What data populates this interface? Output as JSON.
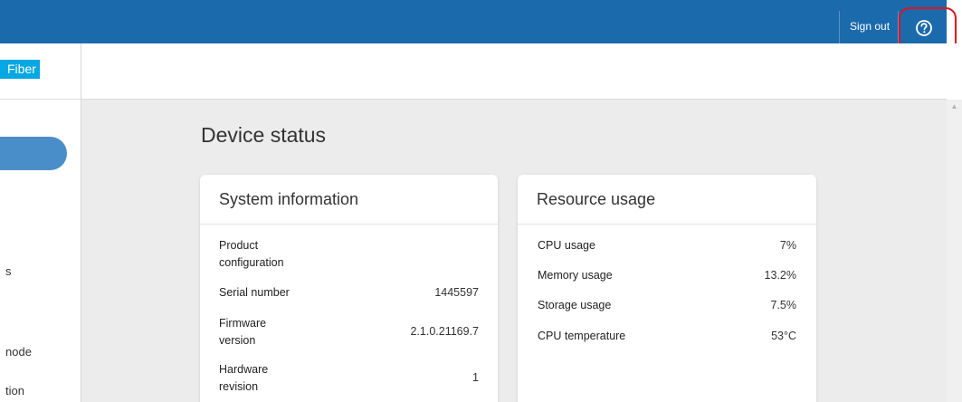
{
  "topbar": {
    "sign_out_label": "Sign out",
    "help_icon": "question-circle-icon"
  },
  "sidebar": {
    "logo_text": "Fiber",
    "items": [
      {
        "label": "s"
      },
      {
        "label": "node"
      },
      {
        "label": "tion"
      }
    ]
  },
  "main": {
    "title": "Device status",
    "system_info": {
      "title": "System information",
      "rows": [
        {
          "label": "Product configuration",
          "value": ""
        },
        {
          "label": "Serial number",
          "value": "1445597"
        },
        {
          "label": "Firmware version",
          "value": "2.1.0.21169.7"
        },
        {
          "label": "Hardware revision",
          "value": "1"
        }
      ]
    },
    "resource_usage": {
      "title": "Resource usage",
      "rows": [
        {
          "label": "CPU usage",
          "value": "7%"
        },
        {
          "label": "Memory usage",
          "value": "13.2%"
        },
        {
          "label": "Storage usage",
          "value": "7.5%"
        },
        {
          "label": "CPU temperature",
          "value": "53°C"
        }
      ]
    }
  },
  "colors": {
    "topbar": "#1b6aac",
    "logo_accent": "#06a7e2",
    "highlight": "#e0141e",
    "main_bg": "#ececec"
  }
}
